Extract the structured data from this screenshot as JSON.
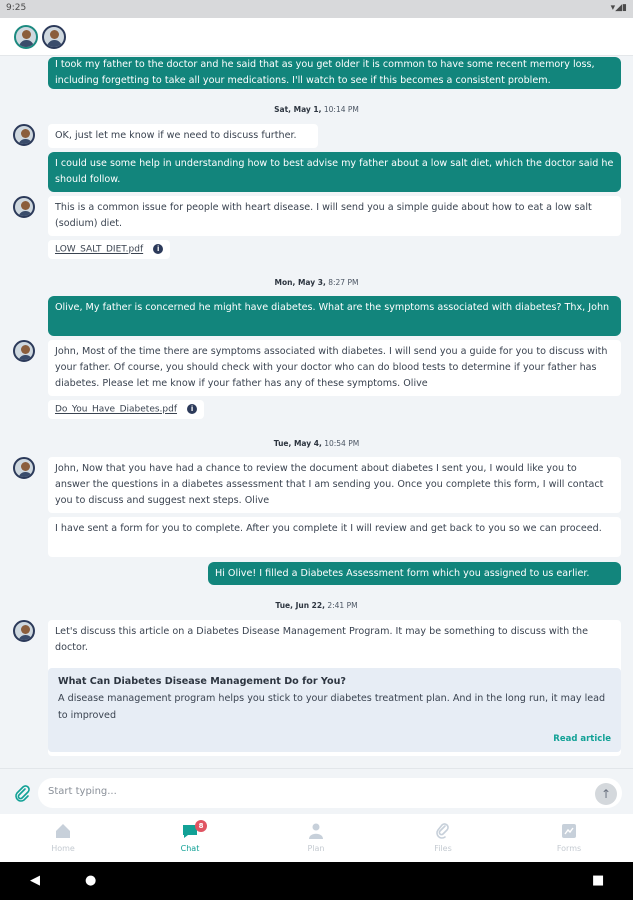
{
  "status_bar": {
    "time": "9:25",
    "icons": "▾◢▮"
  },
  "header": {
    "avatars": [
      "advisor-avatar",
      "user-avatar"
    ]
  },
  "chat": {
    "messages": [
      {
        "type": "out",
        "text": "I took my father to the doctor and he said that as you get older it is common to have some recent memory loss, including forgetting to take all your medications. I'll watch to see if this becomes a consistent problem."
      },
      {
        "type": "date",
        "day": "Sat, May 1,",
        "time": " 10:14 PM"
      },
      {
        "type": "in",
        "text": "OK, just let me know if we need to discuss further."
      },
      {
        "type": "out",
        "text": "I could use some help in understanding how to best advise my father about a low salt diet, which the doctor said he should follow."
      },
      {
        "type": "in",
        "text": "This is a common issue for people with heart disease. I will send you a simple guide about how to eat a low salt (sodium) diet."
      },
      {
        "type": "file",
        "text": "LOW_SALT_DIET.pdf"
      },
      {
        "type": "date",
        "day": "Mon, May 3,",
        "time": " 8:27 PM"
      },
      {
        "type": "out",
        "text": "Olive, My father is concerned he might have diabetes. What are the symptoms associated with diabetes? Thx, John"
      },
      {
        "type": "in",
        "text": "John, Most of the time there are symptoms associated with diabetes. I will send you a guide for you to discuss with your father. Of course, you should check with your doctor who can do blood tests to determine if your father has diabetes. Please let me know if your father has any of these symptoms. Olive"
      },
      {
        "type": "file",
        "text": "Do_You_Have_Diabetes.pdf"
      },
      {
        "type": "date",
        "day": "Tue, May 4,",
        "time": " 10:54 PM"
      },
      {
        "type": "in",
        "text": "John, Now that you have had a chance to review the document about diabetes I sent you, I would like you to answer the questions in a diabetes assessment that I am sending you. Once you complete this form, I will contact you to discuss and suggest next steps. Olive"
      },
      {
        "type": "in",
        "text": "I have sent a form for you to complete. After you complete it I will review and get back to you so we can proceed."
      },
      {
        "type": "out",
        "text": "Hi Olive! I filled a Diabetes Assessment form which you assigned to us earlier."
      },
      {
        "type": "date",
        "day": "Tue, Jun 22,",
        "time": " 2:41 PM"
      },
      {
        "type": "in",
        "text": "Let's discuss this article on a Diabetes Disease Management Program. It may be something to discuss with the doctor."
      }
    ],
    "article": {
      "title": "What Can Diabetes Disease Management Do for You?",
      "body": "A disease management program helps you stick to your diabetes treatment plan. And in the long run, it may lead to improved",
      "link": "Read article"
    }
  },
  "input": {
    "placeholder": "Start typing..."
  },
  "tabs": [
    {
      "label": "Home",
      "icon": "home-icon"
    },
    {
      "label": "Chat",
      "icon": "chat-icon",
      "badge": "8"
    },
    {
      "label": "Plan",
      "icon": "plan-icon"
    },
    {
      "label": "Files",
      "icon": "files-icon"
    },
    {
      "label": "Forms",
      "icon": "forms-icon"
    }
  ],
  "colors": {
    "accent": "#12857c",
    "tab_active": "#12a196",
    "badge": "#e05563"
  }
}
